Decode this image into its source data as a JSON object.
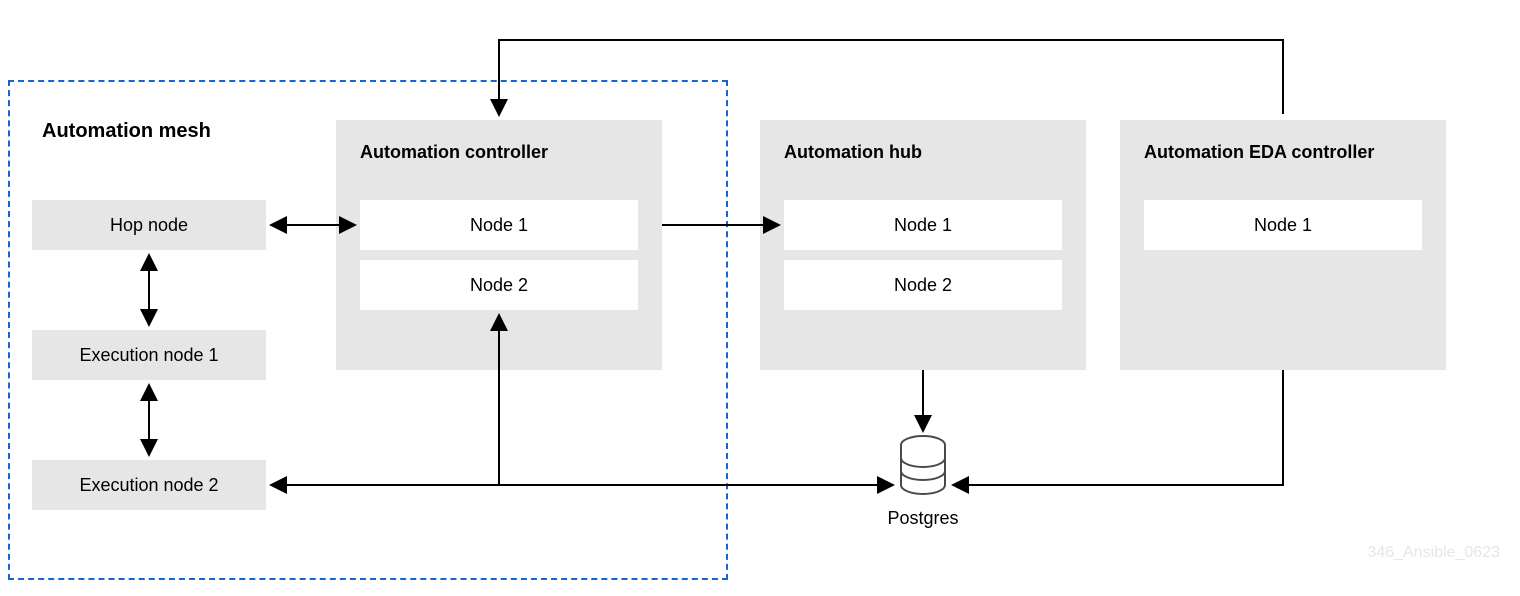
{
  "mesh": {
    "title": "Automation mesh",
    "hop": "Hop node",
    "exec1": "Execution node 1",
    "exec2": "Execution node 2"
  },
  "controller": {
    "title": "Automation controller",
    "node1": "Node 1",
    "node2": "Node 2"
  },
  "hub": {
    "title": "Automation hub",
    "node1": "Node 1",
    "node2": "Node 2"
  },
  "eda": {
    "title": "Automation EDA controller",
    "node1": "Node 1"
  },
  "database": {
    "label": "Postgres"
  },
  "watermark": "346_Ansible_0623"
}
